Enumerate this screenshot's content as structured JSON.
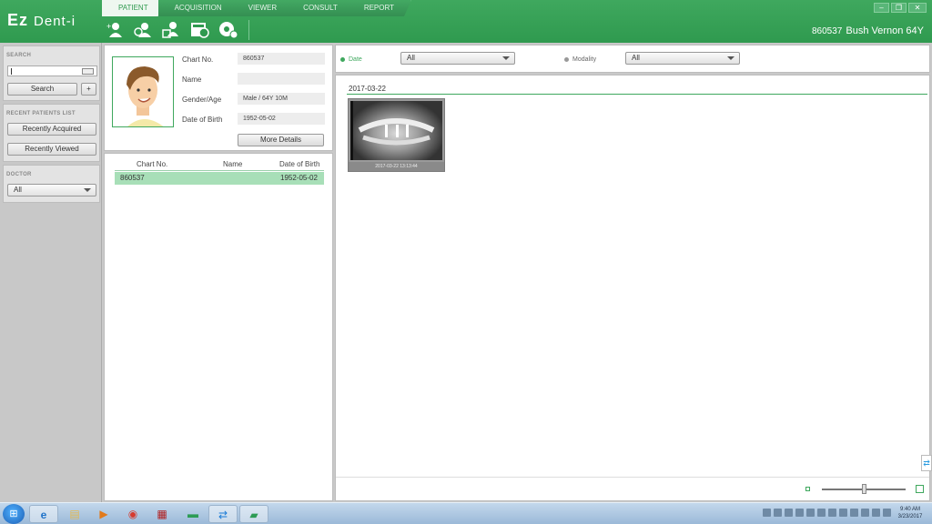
{
  "app": {
    "logo_main": "Ez",
    "logo_sub": "Dent-i",
    "tabs": [
      "PATIENT",
      "ACQUISITION",
      "VIEWER",
      "CONSULT",
      "REPORT"
    ],
    "patient_id": "860537",
    "patient_title": "Bush Vernon 64Y"
  },
  "toolbar": {
    "icons": [
      "add-patient-icon",
      "edit-patient-icon",
      "delete-patient-icon",
      "import-icon",
      "dicom-icon"
    ]
  },
  "sidebar": {
    "search_title": "SEARCH",
    "search_value": "",
    "search_button": "Search",
    "plus_button": "+",
    "recent_title": "RECENT PATIENTS LIST",
    "recently_acquired": "Recently Acquired",
    "recently_viewed": "Recently Viewed",
    "doctor_title": "DOCTOR",
    "doctor_value": "All"
  },
  "patient_info": {
    "chart_label": "Chart No.",
    "chart_value": "860537",
    "name_label": "Name",
    "name_value": "",
    "gender_label": "Gender/Age",
    "gender_value": "Male / 64Y 10M",
    "dob_label": "Date of Birth",
    "dob_value": "1952-05-02",
    "more_details": "More Details"
  },
  "patient_list": {
    "columns": [
      "Chart No.",
      "Name",
      "Date of Birth"
    ],
    "rows": [
      {
        "chart": "860537",
        "name": "",
        "dob": "1952-05-02"
      }
    ]
  },
  "filters": {
    "date_label": "Date",
    "date_value": "All",
    "modality_label": "Modality",
    "modality_value": "All"
  },
  "studies": {
    "date": "2017-03-22",
    "thumbnail_caption": "2017-03-22 13:13:44"
  },
  "zoom_level": 0.5,
  "taskbar": {
    "time": "9:40 AM",
    "date": "3/23/2017"
  },
  "colors": {
    "brand_green": "#3fa85e",
    "selected_row": "#a8dfb8"
  }
}
